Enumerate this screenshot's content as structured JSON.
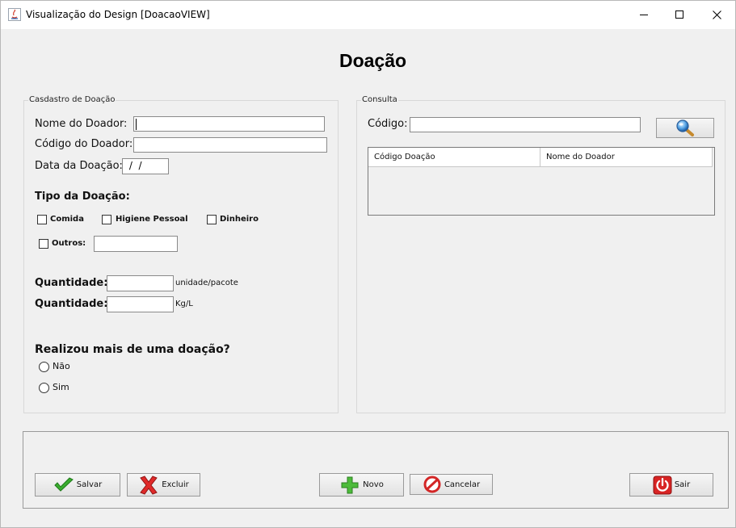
{
  "window": {
    "title": "Visualização do Design [DoacaoVIEW]",
    "controls": [
      "minimize",
      "maximize",
      "close"
    ]
  },
  "heading": "Doação",
  "cadastro": {
    "group_title": "Casdastro de Doação",
    "nome_label": "Nome do Doador:",
    "nome_value": "",
    "codigo_label": "Código do Doador:",
    "codigo_value": "",
    "data_label": "Data da Doação:",
    "data_value": " /  /",
    "tipo_label": "Tipo da Doação:",
    "checkboxes": [
      {
        "label": "Comida",
        "checked": false
      },
      {
        "label": "Higiene Pessoal",
        "checked": false
      },
      {
        "label": "Dinheiro",
        "checked": false
      },
      {
        "label": "Outros:",
        "checked": false
      }
    ],
    "outros_value": "",
    "quantidade1_label": "Quantidade:",
    "quantidade1_value": "",
    "quantidade1_unit": "unidade/pacote",
    "quantidade2_label": "Quantidade:",
    "quantidade2_value": "",
    "quantidade2_unit": "Kg/L",
    "pergunta": "Realizou mais de uma doação?",
    "radios": [
      {
        "label": "Não",
        "selected": false
      },
      {
        "label": "Sim",
        "selected": false
      }
    ]
  },
  "consulta": {
    "group_title": "Consulta",
    "codigo_label": "Código:",
    "codigo_value": "",
    "table_headers": [
      "Código Doação",
      "Nome do Doador"
    ],
    "table_rows": []
  },
  "actions": {
    "salvar": "Salvar",
    "excluir": "Excluir",
    "novo": "Novo",
    "cancelar": "Cancelar",
    "sair": "Sair"
  },
  "colors": {
    "background": "#f0f0f0",
    "check_green": "#2f9e27",
    "excluir_red": "#d92b2b",
    "sair_red": "#d82424",
    "search_blue": "#3e8fd8"
  }
}
